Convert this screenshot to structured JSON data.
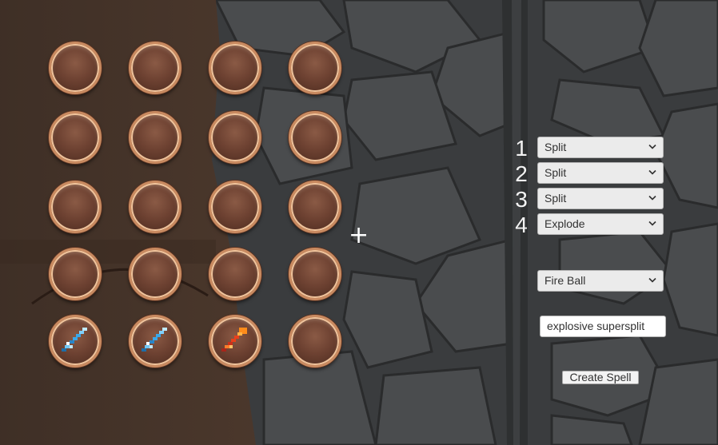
{
  "crosshair": {
    "glyph": "+"
  },
  "inventory": {
    "rows": [
      [
        "empty",
        "empty",
        "empty",
        "empty"
      ],
      [
        "empty",
        "empty",
        "empty",
        "empty"
      ],
      [
        "empty",
        "empty",
        "empty",
        "empty"
      ],
      [
        "empty",
        "empty",
        "empty",
        "empty"
      ],
      [
        "ice-dagger-icon",
        "ice-dagger-icon",
        "fire-dagger-icon",
        "empty"
      ]
    ]
  },
  "spell_builder": {
    "slots": [
      {
        "number": "1",
        "modifier": "Split"
      },
      {
        "number": "2",
        "modifier": "Split"
      },
      {
        "number": "3",
        "modifier": "Split"
      },
      {
        "number": "4",
        "modifier": "Explode"
      }
    ],
    "base_spell": "Fire Ball",
    "spell_name": "explosive supersplit",
    "create_button_label": "Create Spell"
  },
  "colors": {
    "slot_rim": "#c98a60",
    "slot_fill": "#6e4232",
    "ice": "#3aa7e8",
    "fire": "#e8401c"
  }
}
